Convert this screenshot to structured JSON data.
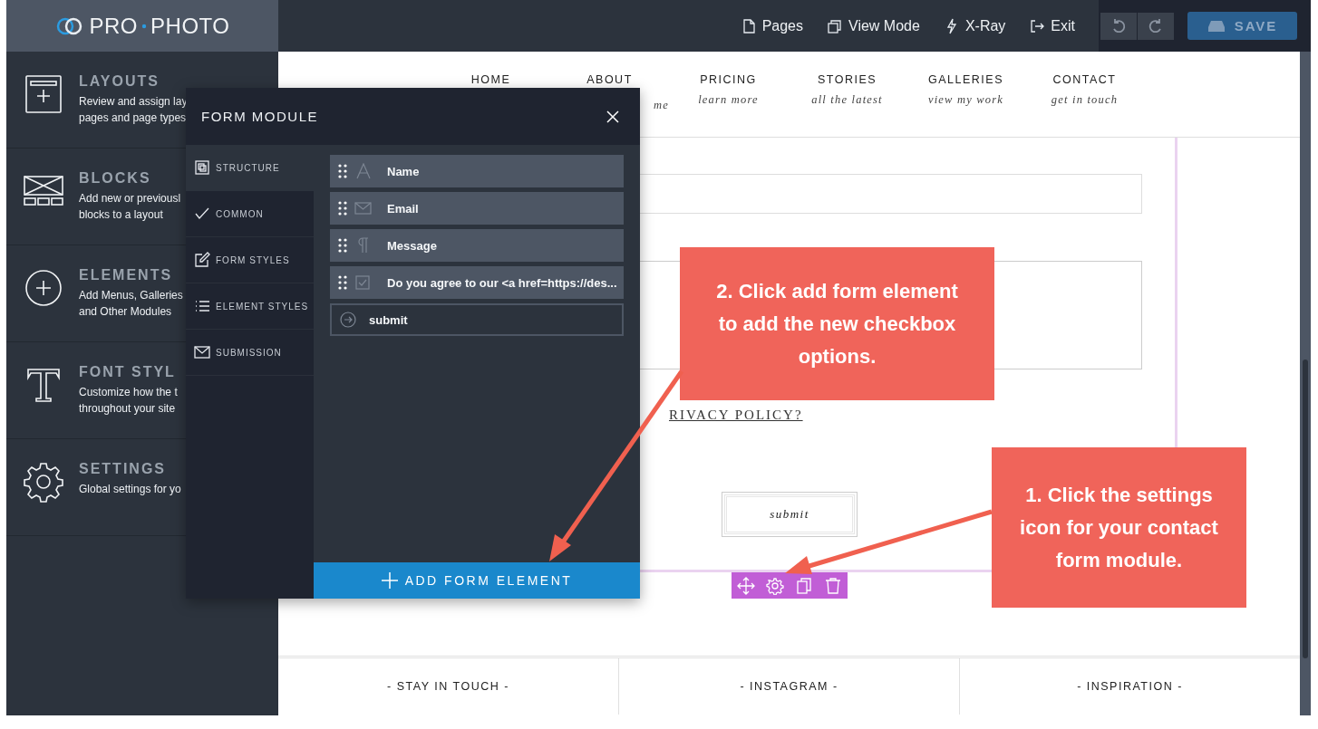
{
  "logo": {
    "left": "PRO",
    "right": "PHOTO"
  },
  "toolbar": [
    {
      "label": "Pages"
    },
    {
      "label": "View Mode"
    },
    {
      "label": "X-Ray"
    },
    {
      "label": "Exit"
    }
  ],
  "save_button": "SAVE",
  "sidebar": [
    {
      "title": "LAYOUTS",
      "lines": [
        "Review and assign lay",
        "pages and page types"
      ]
    },
    {
      "title": "BLOCKS",
      "lines": [
        "Add new or previousl",
        "blocks to a layout"
      ]
    },
    {
      "title": "ELEMENTS",
      "lines": [
        "Add Menus, Galleries",
        "and Other Modules"
      ]
    },
    {
      "title": "FONT STYL",
      "lines": [
        "Customize how the t",
        "throughout your site"
      ]
    },
    {
      "title": "SETTINGS",
      "lines": [
        "Global settings for yo"
      ]
    }
  ],
  "nav": [
    {
      "label": "HOME"
    },
    {
      "label": "ABOUT",
      "sub": "me"
    },
    {
      "label": "PRICING",
      "sub": "learn more"
    },
    {
      "label": "STORIES",
      "sub": "all the latest"
    },
    {
      "label": "GALLERIES",
      "sub": "view my work"
    },
    {
      "label": "CONTACT",
      "sub": "get in touch"
    }
  ],
  "form": {
    "link": "RIVACY POLICY?",
    "submit": "submit"
  },
  "footer": [
    "- STAY IN TOUCH -",
    "- INSTAGRAM -",
    "- INSPIRATION -"
  ],
  "modal": {
    "title": "FORM MODULE",
    "tabs": [
      {
        "label": "STRUCTURE",
        "selected": true
      },
      {
        "label": "COMMON",
        "selected": false
      },
      {
        "label": "FORM STYLES",
        "selected": false
      },
      {
        "label": "ELEMENT STYLES",
        "selected": false
      },
      {
        "label": "SUBMISSION",
        "selected": false
      }
    ],
    "fields": [
      {
        "label": "Name",
        "kind": "text"
      },
      {
        "label": "Email",
        "kind": "email"
      },
      {
        "label": "Message",
        "kind": "paragraph"
      },
      {
        "label": "Do you agree to our <a href=https://des...",
        "kind": "checkbox"
      },
      {
        "label": "submit",
        "kind": "submit"
      }
    ],
    "add_button": "ADD FORM ELEMENT"
  },
  "callouts": [
    {
      "text": "2. Click add form element to add the new checkbox options."
    },
    {
      "text": "1. Click the settings icon for your contact form module."
    }
  ]
}
